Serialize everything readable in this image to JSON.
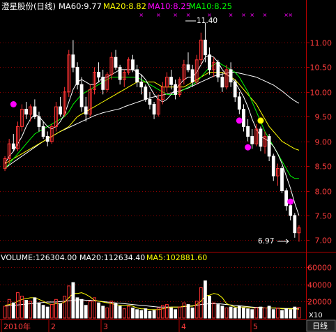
{
  "price_header": {
    "stock_name": "澄星股份(日线)",
    "ma60_text": "MA60:9.77",
    "ma20_text": "MA20:8.82",
    "ma10a_text": "MA10:8.25",
    "ma10b_text": "MA10:8.25",
    "colors": {
      "name": "#ffffff",
      "ma60": "#ffffff",
      "ma20": "#ffff00",
      "ma10a": "#ff00ff",
      "ma10b": "#00ff00"
    }
  },
  "volume_header": {
    "volume_text": "VOLUME:126304.00",
    "ma20_text": "MA20:112634.40",
    "ma5_text": "MA5:102881.60",
    "colors": {
      "volume": "#ffffff",
      "ma20": "#ffffff",
      "ma5": "#ffff00"
    }
  },
  "annotations": {
    "high_label": "11.40",
    "low_label": "6.97"
  },
  "x_axis_labels": [
    "2010年",
    "2",
    "3",
    "4",
    "5"
  ],
  "multiplier_label": "X10",
  "period_button": "日线",
  "colors": {
    "up": "#ff3232",
    "down": "#ffffff",
    "ma5": "#ffffff",
    "ma10": "#00ff00",
    "ma20": "#ffff00",
    "ma60": "#ffffff",
    "axis": "#b40000",
    "grid": "#b40000",
    "markers_magenta": "#ff00ff",
    "markers_yellow": "#ffff00",
    "axis_text": "#ff3c3c"
  },
  "chart_data": [
    {
      "type": "candlestick",
      "title": "澄星股份(日线)",
      "y_ticks": [
        7.0,
        7.5,
        8.0,
        8.5,
        9.0,
        9.5,
        10.0,
        10.5,
        11.0
      ],
      "ylim": [
        6.85,
        11.55
      ],
      "x_ticks": [
        "2010年",
        "2",
        "3",
        "4",
        "5"
      ],
      "high": 11.4,
      "low": 6.97,
      "ohlc": [
        [
          8.45,
          8.7,
          8.4,
          8.65
        ],
        [
          8.65,
          9.05,
          8.55,
          8.95
        ],
        [
          8.95,
          9.15,
          8.8,
          8.85
        ],
        [
          8.85,
          9.4,
          8.8,
          9.3
        ],
        [
          9.3,
          9.75,
          9.2,
          9.65
        ],
        [
          9.65,
          9.8,
          9.45,
          9.55
        ],
        [
          9.55,
          9.75,
          9.4,
          9.7
        ],
        [
          9.7,
          9.85,
          9.45,
          9.5
        ],
        [
          9.5,
          9.6,
          9.2,
          9.3
        ],
        [
          9.3,
          9.4,
          9.05,
          9.1
        ],
        [
          9.1,
          9.2,
          8.9,
          9.0
        ],
        [
          9.0,
          9.35,
          8.95,
          9.3
        ],
        [
          9.3,
          9.8,
          9.2,
          9.7
        ],
        [
          9.7,
          9.9,
          9.5,
          9.55
        ],
        [
          9.55,
          10.1,
          9.5,
          10.0
        ],
        [
          10.0,
          10.85,
          9.9,
          10.75
        ],
        [
          10.75,
          11.05,
          10.4,
          10.5
        ],
        [
          10.5,
          10.6,
          10.05,
          10.15
        ],
        [
          10.15,
          10.3,
          9.6,
          9.7
        ],
        [
          9.7,
          9.9,
          9.4,
          9.55
        ],
        [
          9.55,
          10.15,
          9.5,
          10.05
        ],
        [
          10.05,
          10.5,
          9.95,
          10.4
        ],
        [
          10.4,
          10.6,
          10.2,
          10.3
        ],
        [
          10.3,
          10.45,
          9.95,
          10.05
        ],
        [
          10.05,
          10.4,
          10.0,
          10.35
        ],
        [
          10.35,
          10.8,
          10.25,
          10.7
        ],
        [
          10.7,
          10.85,
          10.45,
          10.5
        ],
        [
          10.5,
          10.55,
          10.15,
          10.25
        ],
        [
          10.25,
          10.45,
          10.1,
          10.4
        ],
        [
          10.4,
          10.7,
          10.35,
          10.65
        ],
        [
          10.65,
          10.75,
          10.4,
          10.45
        ],
        [
          10.45,
          10.55,
          10.1,
          10.2
        ],
        [
          10.2,
          10.35,
          9.95,
          10.1
        ],
        [
          10.1,
          10.15,
          9.8,
          9.85
        ],
        [
          9.85,
          10.0,
          9.65,
          9.75
        ],
        [
          9.75,
          9.8,
          9.45,
          9.55
        ],
        [
          9.55,
          9.95,
          9.5,
          9.85
        ],
        [
          9.85,
          10.2,
          9.75,
          10.1
        ],
        [
          10.1,
          10.4,
          10.0,
          10.3
        ],
        [
          10.3,
          10.45,
          10.05,
          10.15
        ],
        [
          10.15,
          10.25,
          9.85,
          9.95
        ],
        [
          9.95,
          10.3,
          9.9,
          10.25
        ],
        [
          10.25,
          10.65,
          10.15,
          10.55
        ],
        [
          10.55,
          10.8,
          10.4,
          10.45
        ],
        [
          10.45,
          10.55,
          10.1,
          10.2
        ],
        [
          10.2,
          10.75,
          10.15,
          10.65
        ],
        [
          10.65,
          11.2,
          10.55,
          11.05
        ],
        [
          11.05,
          11.4,
          10.6,
          10.75
        ],
        [
          10.75,
          10.9,
          10.35,
          10.45
        ],
        [
          10.45,
          10.7,
          10.3,
          10.6
        ],
        [
          10.6,
          10.65,
          10.2,
          10.3
        ],
        [
          10.3,
          10.4,
          10.0,
          10.1
        ],
        [
          10.1,
          10.55,
          10.05,
          10.45
        ],
        [
          10.45,
          10.6,
          10.1,
          10.2
        ],
        [
          10.2,
          10.25,
          9.8,
          9.9
        ],
        [
          9.9,
          10.0,
          9.55,
          9.65
        ],
        [
          9.65,
          9.75,
          9.2,
          9.3
        ],
        [
          9.3,
          9.45,
          9.0,
          9.1
        ],
        [
          9.1,
          9.25,
          8.85,
          8.95
        ],
        [
          8.95,
          9.35,
          8.9,
          9.25
        ],
        [
          9.25,
          9.3,
          8.8,
          8.9
        ],
        [
          8.9,
          9.2,
          8.75,
          9.1
        ],
        [
          9.1,
          9.15,
          8.6,
          8.7
        ],
        [
          8.7,
          8.75,
          8.2,
          8.3
        ],
        [
          8.3,
          8.55,
          8.1,
          8.45
        ],
        [
          8.45,
          8.5,
          7.95,
          8.0
        ],
        [
          8.0,
          8.05,
          7.6,
          7.7
        ],
        [
          7.7,
          7.8,
          7.4,
          7.5
        ],
        [
          7.5,
          7.55,
          7.05,
          7.15
        ],
        [
          7.15,
          7.3,
          6.97,
          7.25
        ]
      ],
      "ma5": [
        8.55,
        8.7,
        8.8,
        8.95,
        9.1,
        9.3,
        9.45,
        9.55,
        9.5,
        9.4,
        9.3,
        9.25,
        9.3,
        9.4,
        9.55,
        9.8,
        10.05,
        10.2,
        10.25,
        10.2,
        10.15,
        10.15,
        10.2,
        10.3,
        10.3,
        10.35,
        10.4,
        10.45,
        10.45,
        10.45,
        10.45,
        10.4,
        10.35,
        10.25,
        10.1,
        9.95,
        9.85,
        9.8,
        9.85,
        9.95,
        10.05,
        10.15,
        10.25,
        10.3,
        10.3,
        10.4,
        10.55,
        10.7,
        10.75,
        10.7,
        10.6,
        10.45,
        10.35,
        10.3,
        10.2,
        10.05,
        9.9,
        9.7,
        9.45,
        9.25,
        9.1,
        9.05,
        9.0,
        8.9,
        8.75,
        8.55,
        8.3,
        8.05,
        7.75,
        7.5
      ],
      "ma10": [
        8.45,
        8.55,
        8.65,
        8.75,
        8.85,
        8.95,
        9.05,
        9.15,
        9.2,
        9.25,
        9.3,
        9.35,
        9.4,
        9.45,
        9.5,
        9.6,
        9.75,
        9.85,
        9.95,
        10.0,
        10.05,
        10.1,
        10.15,
        10.2,
        10.25,
        10.3,
        10.3,
        10.3,
        10.3,
        10.3,
        10.3,
        10.3,
        10.25,
        10.2,
        10.15,
        10.1,
        10.05,
        10.0,
        9.95,
        9.95,
        9.95,
        10.0,
        10.05,
        10.1,
        10.15,
        10.2,
        10.3,
        10.4,
        10.5,
        10.55,
        10.6,
        10.55,
        10.5,
        10.45,
        10.4,
        10.3,
        10.15,
        10.0,
        9.8,
        9.6,
        9.4,
        9.2,
        9.05,
        8.9,
        8.75,
        8.6,
        8.45,
        8.3,
        8.25,
        8.25
      ],
      "ma20": [
        8.55,
        8.6,
        8.65,
        8.7,
        8.75,
        8.8,
        8.85,
        8.9,
        8.95,
        9.0,
        9.05,
        9.1,
        9.15,
        9.2,
        9.25,
        9.3,
        9.4,
        9.5,
        9.55,
        9.6,
        9.65,
        9.7,
        9.75,
        9.8,
        9.85,
        9.9,
        9.95,
        10.0,
        10.05,
        10.1,
        10.15,
        10.2,
        10.2,
        10.2,
        10.2,
        10.2,
        10.15,
        10.1,
        10.1,
        10.1,
        10.1,
        10.1,
        10.1,
        10.15,
        10.2,
        10.25,
        10.3,
        10.35,
        10.4,
        10.4,
        10.4,
        10.4,
        10.35,
        10.3,
        10.25,
        10.15,
        10.05,
        9.95,
        9.85,
        9.75,
        9.6,
        9.45,
        9.3,
        9.2,
        9.1,
        9.0,
        8.95,
        8.9,
        8.85,
        8.82
      ],
      "ma60": [
        8.45,
        8.52,
        8.58,
        8.64,
        8.7,
        8.76,
        8.82,
        8.88,
        8.94,
        9.0,
        9.05,
        9.1,
        9.15,
        9.2,
        9.24,
        9.28,
        9.32,
        9.36,
        9.4,
        9.44,
        9.48,
        9.52,
        9.55,
        9.58,
        9.6,
        9.62,
        9.64,
        9.66,
        9.7,
        9.73,
        9.76,
        9.79,
        9.82,
        9.85,
        9.88,
        9.9,
        9.92,
        9.94,
        9.96,
        9.98,
        10.0,
        10.02,
        10.05,
        10.08,
        10.12,
        10.16,
        10.2,
        10.24,
        10.28,
        10.32,
        10.34,
        10.36,
        10.38,
        10.4,
        10.4,
        10.38,
        10.36,
        10.34,
        10.32,
        10.3,
        10.26,
        10.22,
        10.18,
        10.14,
        10.08,
        10.02,
        9.95,
        9.88,
        9.82,
        9.77
      ]
    },
    {
      "type": "bar",
      "title": "VOLUME",
      "y_ticks": [
        20000,
        40000,
        60000
      ],
      "ylim": [
        0,
        66000
      ],
      "volume": [
        14000,
        22000,
        18000,
        30000,
        26000,
        21000,
        20000,
        24000,
        18000,
        15000,
        13000,
        16000,
        22000,
        17000,
        26000,
        38000,
        42000,
        24000,
        22000,
        15000,
        20000,
        24000,
        18000,
        14000,
        12000,
        20000,
        17000,
        14000,
        11000,
        14000,
        12000,
        10000,
        9000,
        11000,
        8000,
        9000,
        12000,
        15000,
        16000,
        12000,
        10000,
        13000,
        18000,
        16000,
        12000,
        20000,
        36000,
        44000,
        26000,
        18000,
        16000,
        14000,
        12000,
        13000,
        12000,
        14000,
        12000,
        11000,
        10000,
        12000,
        13000,
        12000,
        14000,
        10000,
        12000,
        9000,
        11000,
        10000,
        13000,
        12600
      ],
      "vol_ma5": [
        15000,
        16000,
        17000,
        20000,
        22000,
        23000,
        24000,
        24000,
        22000,
        20000,
        17000,
        16000,
        17000,
        17000,
        19000,
        24000,
        29000,
        29000,
        30000,
        28000,
        25000,
        21000,
        20000,
        19000,
        18000,
        17000,
        16000,
        15000,
        15000,
        15000,
        14000,
        12000,
        11000,
        11000,
        10000,
        10000,
        10000,
        11000,
        12000,
        13000,
        13000,
        13000,
        14000,
        14000,
        14000,
        16000,
        20000,
        26000,
        27000,
        29000,
        28000,
        24000,
        17000,
        15000,
        13000,
        13000,
        13000,
        13000,
        12000,
        12000,
        12000,
        12000,
        12000,
        12000,
        12000,
        11000,
        11000,
        11000,
        11000,
        10288
      ],
      "vol_ma20": [
        14000,
        14500,
        15000,
        15500,
        16000,
        16500,
        17000,
        17500,
        18000,
        18500,
        19000,
        19000,
        19000,
        19500,
        20000,
        20500,
        21000,
        21500,
        21500,
        21000,
        21000,
        20500,
        20000,
        19500,
        19000,
        18500,
        18000,
        17500,
        17000,
        16500,
        16000,
        15500,
        15000,
        14500,
        14000,
        13500,
        13000,
        13000,
        13000,
        13000,
        13000,
        13000,
        13500,
        14000,
        14500,
        15000,
        16000,
        16500,
        17000,
        17000,
        17000,
        16500,
        16000,
        15500,
        15000,
        14500,
        14000,
        13500,
        13000,
        12500,
        12500,
        12000,
        12000,
        11800,
        11600,
        11500,
        11400,
        11300,
        11263,
        11263
      ]
    }
  ]
}
